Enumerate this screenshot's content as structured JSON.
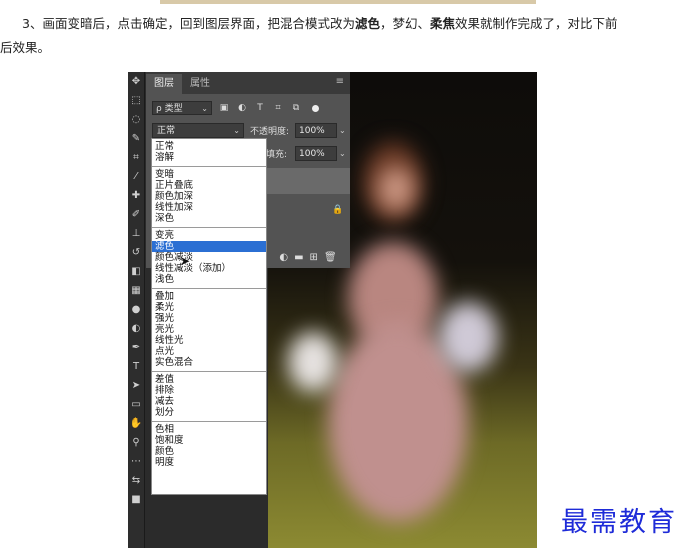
{
  "article": {
    "line1_a": "3、画面变暗后，点击确定，回到图层界面，把混合模式改为",
    "bold1": "滤色",
    "line1_b": "，梦幻、",
    "bold2": "柔焦",
    "line1_c": "效果就制作完成了，对比下前",
    "line2": "后效果。"
  },
  "panel": {
    "tabs": [
      "图层",
      "属性"
    ],
    "menu_icon": "panel-menu-icon",
    "filter_label": "ρ 类型",
    "blend_mode_value": "正常",
    "opacity_label": "不透明度:",
    "opacity_value": "100%",
    "fill_label": "填充:",
    "fill_value": "100%"
  },
  "blend_modes": [
    [
      "正常",
      "溶解"
    ],
    [
      "变暗",
      "正片叠底",
      "颜色加深",
      "线性加深",
      "深色"
    ],
    [
      "变亮",
      "滤色",
      "颜色减淡",
      "线性减淡（添加）",
      "浅色"
    ],
    [
      "叠加",
      "柔光",
      "强光",
      "亮光",
      "线性光",
      "点光",
      "实色混合"
    ],
    [
      "差值",
      "排除",
      "减去",
      "划分"
    ],
    [
      "色相",
      "饱和度",
      "颜色",
      "明度"
    ]
  ],
  "selected_mode": "滤色",
  "watermark": "最需教育",
  "colors": {
    "selection": "#2b6fd3",
    "watermark": "#1e2bd8",
    "panel": "#535353"
  }
}
